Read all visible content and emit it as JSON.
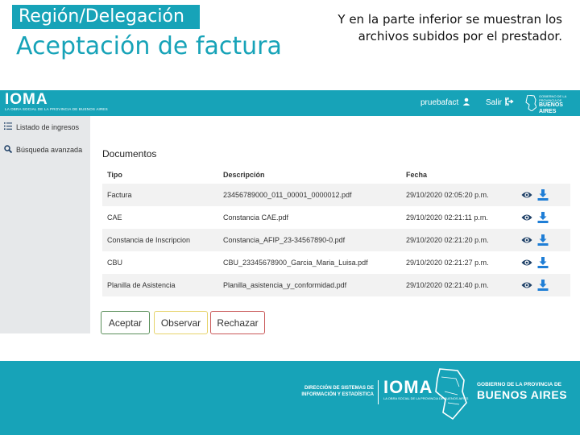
{
  "slide": {
    "region_label": "Región/Delegación",
    "title": "Aceptación de factura",
    "note": "Y en la parte inferior se muestran los archivos subidos por el prestador."
  },
  "header": {
    "logo": "IOMA",
    "logo_sub": "LA OBRA SOCIAL DE LA PROVINCIA DE BUENOS AIRES",
    "username": "pruebafact",
    "salir": "Salir",
    "gov_small": "GOBIERNO DE LA PROVINCIA DE",
    "gov_big": "BUENOS AIRES"
  },
  "sidebar": {
    "items": [
      {
        "label": "Listado de ingresos",
        "icon": "list-icon"
      },
      {
        "label": "Búsqueda avanzada",
        "icon": "search-icon"
      }
    ]
  },
  "documents": {
    "title": "Documentos",
    "headers": [
      "Tipo",
      "Descripción",
      "Fecha"
    ],
    "rows": [
      {
        "tipo": "Factura",
        "descripcion": "23456789000_011_00001_0000012.pdf",
        "fecha": "29/10/2020 02:05:20 p.m."
      },
      {
        "tipo": "CAE",
        "descripcion": "Constancia CAE.pdf",
        "fecha": "29/10/2020 02:21:11 p.m."
      },
      {
        "tipo": "Constancia de Inscripcion",
        "descripcion": "Constancia_AFIP_23-34567890-0.pdf",
        "fecha": "29/10/2020 02:21:20 p.m."
      },
      {
        "tipo": "CBU",
        "descripcion": "CBU_23345678900_Garcia_Maria_Luisa.pdf",
        "fecha": "29/10/2020 02:21:27 p.m."
      },
      {
        "tipo": "Planilla de Asistencia",
        "descripcion": "Planilla_asistencia_y_conformidad.pdf",
        "fecha": "29/10/2020 02:21:40 p.m."
      }
    ]
  },
  "buttons": {
    "aceptar": "Aceptar",
    "observar": "Observar",
    "rechazar": "Rechazar"
  },
  "footer": {
    "direccion_l1": "DIRECCIÓN DE SISTEMAS DE",
    "direccion_l2": "INFORMACIÓN Y ESTADÍSTICA",
    "ioma": "IOMA",
    "ioma_sub": "LA OBRA SOCIAL DE LA PROVINCIA DE BUENOS AIRES",
    "gov_small": "GOBIERNO DE LA PROVINCIA DE",
    "gov_big": "BUENOS AIRES"
  },
  "colors": {
    "accent": "#17a3b8",
    "sidebar_bg": "#e6e8ea",
    "aceptar_border": "#5a8f5a",
    "observar_border": "#e6d36a",
    "rechazar_border": "#c95757"
  }
}
